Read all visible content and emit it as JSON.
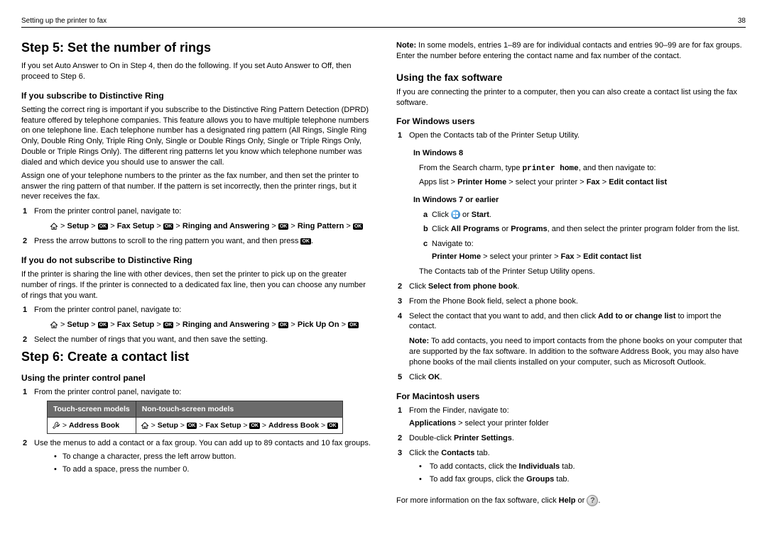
{
  "header": {
    "left": "Setting up the printer to fax",
    "page": "38"
  },
  "left": {
    "h1a": "Step 5: Set the number of rings",
    "p1": "If you set Auto Answer to On in Step 4, then do the following. If you set Auto Answer to Off, then proceed to Step 6.",
    "h3a": "If you subscribe to Distinctive Ring",
    "p2": "Setting the correct ring is important if you subscribe to the Distinctive Ring Pattern Detection (DPRD) feature offered by telephone companies. This feature allows you to have multiple telephone numbers on one telephone line. Each telephone number has a designated ring pattern (All Rings, Single Ring Only, Double Ring Only, Triple Ring Only, Single or Double Rings Only, Single or Triple Rings Only, Double or Triple Rings Only). The different ring patterns let you know which telephone number was dialed and which device you should use to answer the call.",
    "p3": "Assign one of your telephone numbers to the printer as the fax number, and then set the printer to answer the ring pattern of that number. If the pattern is set incorrectly, then the printer rings, but it never receives the fax.",
    "li1": "From the printer control panel, navigate to:",
    "path1": {
      "a": "Setup",
      "b": "Fax Setup",
      "c": "Ringing and Answering",
      "d": "Ring Pattern"
    },
    "li2a": "Press the arrow buttons to scroll to the ring pattern you want, and then press ",
    "li2b": ".",
    "h3b": "If you do not subscribe to Distinctive Ring",
    "p4": "If the printer is sharing the line with other devices, then set the printer to pick up on the greater number of rings. If the printer is connected to a dedicated fax line, then you can choose any number of rings that you want.",
    "li3": "From the printer control panel, navigate to:",
    "path2": {
      "a": "Setup",
      "b": "Fax Setup",
      "c": "Ringing and Answering",
      "d": "Pick Up On"
    },
    "li4": "Select the number of rings that you want, and then save the setting.",
    "h1b": "Step 6: Create a contact list",
    "h3c": "Using the printer control panel",
    "li5": "From the printer control panel, navigate to:",
    "table": {
      "th1": "Touch-screen models",
      "th2": "Non-touch-screen models",
      "td1": "Address Book",
      "td2a": "Setup",
      "td2b": "Fax Setup",
      "td2c": "Address Book"
    },
    "li6": "Use the menus to add a contact or a fax group. You can add up to 89 contacts and 10 fax groups.",
    "b1": "To change a character, press the left arrow button.",
    "b2": "To add a space, press the number 0."
  },
  "right": {
    "note1a": "Note:",
    "note1b": " In some models, entries 1–89 are for individual contacts and entries 90–99 are for fax groups. Enter the number before entering the contact name and fax number of the contact.",
    "h2a": "Using the fax software",
    "p1": "If you are connecting the printer to a computer, then you can also create a contact list using the fax software.",
    "h3a": "For Windows users",
    "li1": "Open the Contacts tab of the Printer Setup Utility.",
    "h4a": "In Windows 8",
    "p2a": "From the Search charm, type ",
    "p2b": "printer home",
    "p2c": ", and then navigate to:",
    "p3a": "Apps list > ",
    "p3b": "Printer Home",
    "p3c": " > select your printer > ",
    "p3d": "Fax",
    "p3e": " > ",
    "p3f": "Edit contact list",
    "h4b": "In Windows 7 or earlier",
    "la": "Click ",
    "la2": " or ",
    "la3": "Start",
    "la4": ".",
    "lb1": "Click ",
    "lb2": "All Programs",
    "lb3": " or ",
    "lb4": "Programs",
    "lb5": ", and then select the printer program folder from the list.",
    "lc": "Navigate to:",
    "lc2a": "Printer Home",
    "lc2b": " > select your printer > ",
    "lc2c": "Fax",
    "lc2d": " > ",
    "lc2e": "Edit contact list",
    "p4": "The Contacts tab of the Printer Setup Utility opens.",
    "li2a": "Click ",
    "li2b": "Select from phone book",
    "li2c": ".",
    "li3": "From the Phone Book field, select a phone book.",
    "li4a": "Select the contact that you want to add, and then click ",
    "li4b": "Add to or change list",
    "li4c": " to import the contact.",
    "note2a": "Note:",
    "note2b": " To add contacts, you need to import contacts from the phone books on your computer that are supported by the fax software. In addition to the software Address Book, you may also have phone books of the mail clients installed on your computer, such as Microsoft Outlook.",
    "li5a": "Click ",
    "li5b": "OK",
    "li5c": ".",
    "h3b": "For Macintosh users",
    "m1": "From the Finder, navigate to:",
    "m1b1": "Applications",
    "m1b2": " > select your printer folder",
    "m2a": "Double-click ",
    "m2b": "Printer Settings",
    "m2c": ".",
    "m3a": "Click the ",
    "m3b": "Contacts",
    "m3c": " tab.",
    "mb1a": "To add contacts, click the ",
    "mb1b": "Individuals",
    "mb1c": " tab.",
    "mb2a": "To add fax groups, click the ",
    "mb2b": "Groups",
    "mb2c": " tab.",
    "p5a": "For more information on the fax software, click ",
    "p5b": "Help",
    "p5c": " or ",
    "p5d": "."
  }
}
